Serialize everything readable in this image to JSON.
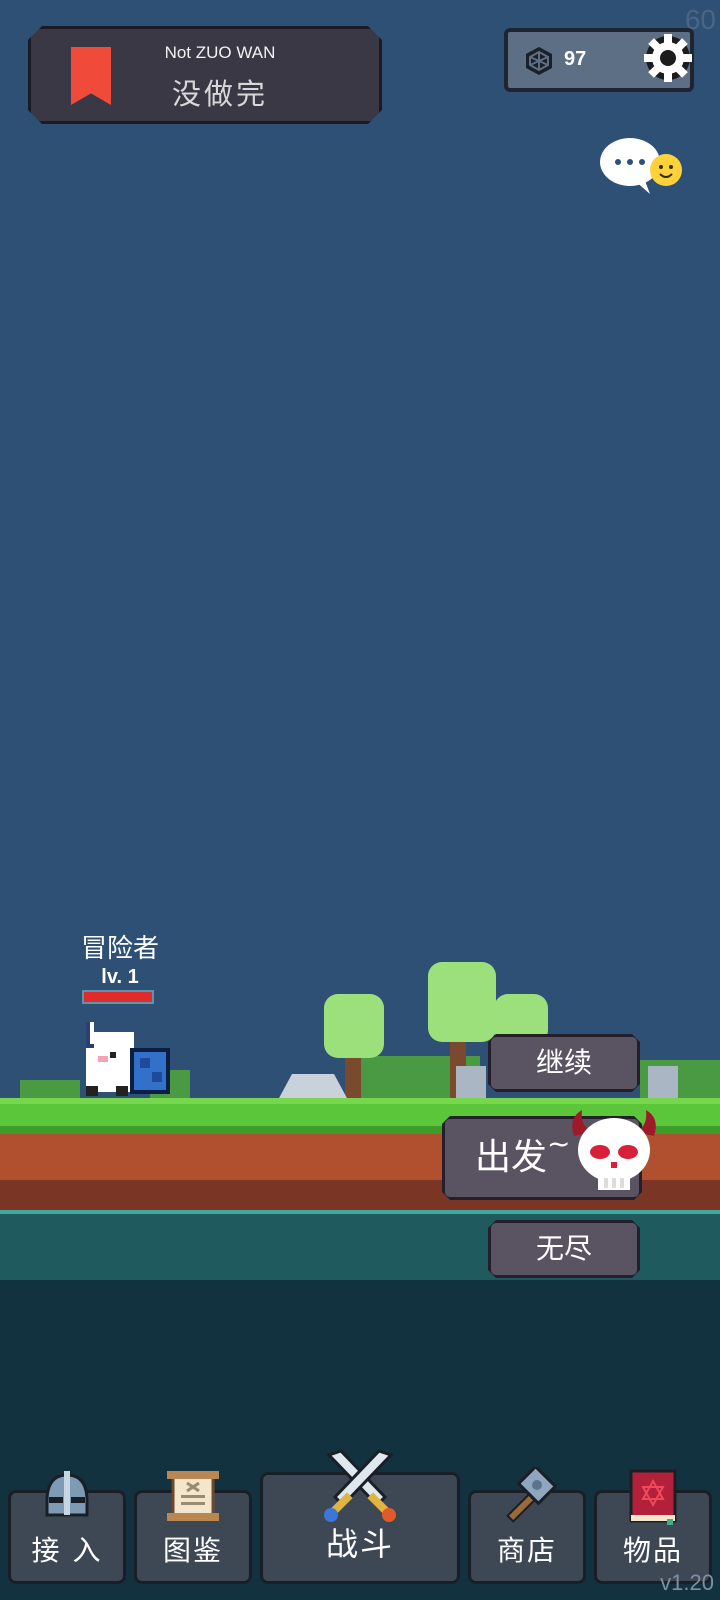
{
  "hud": {
    "fps": "60",
    "banner": {
      "subtitle": "Not ZUO WAN",
      "title": "没做完"
    },
    "currency": {
      "icon": "gem-icon",
      "value": "97"
    },
    "settings_icon": "gear-icon",
    "chat_icon": "chat-bubble-icon"
  },
  "player": {
    "name": "冒险者",
    "level": "lv. 1",
    "hp_fraction": 1.0
  },
  "actions": {
    "continue": "继续",
    "go": "出发",
    "go_suffix": "~",
    "endless": "无尽"
  },
  "nav": [
    {
      "label": "接 入",
      "icon": "helmet-icon"
    },
    {
      "label": "图鉴",
      "icon": "scroll-icon"
    },
    {
      "label": "战斗",
      "icon": "crossed-swords-icon"
    },
    {
      "label": "商店",
      "icon": "hammer-icon"
    },
    {
      "label": "物品",
      "icon": "spellbook-icon"
    }
  ],
  "version": "v1.20",
  "colors": {
    "sky": "#2f5075",
    "grass": "#5cc63a",
    "dirt": "#b0502e",
    "hp": "#e02b2b",
    "button": "#5a5462"
  }
}
